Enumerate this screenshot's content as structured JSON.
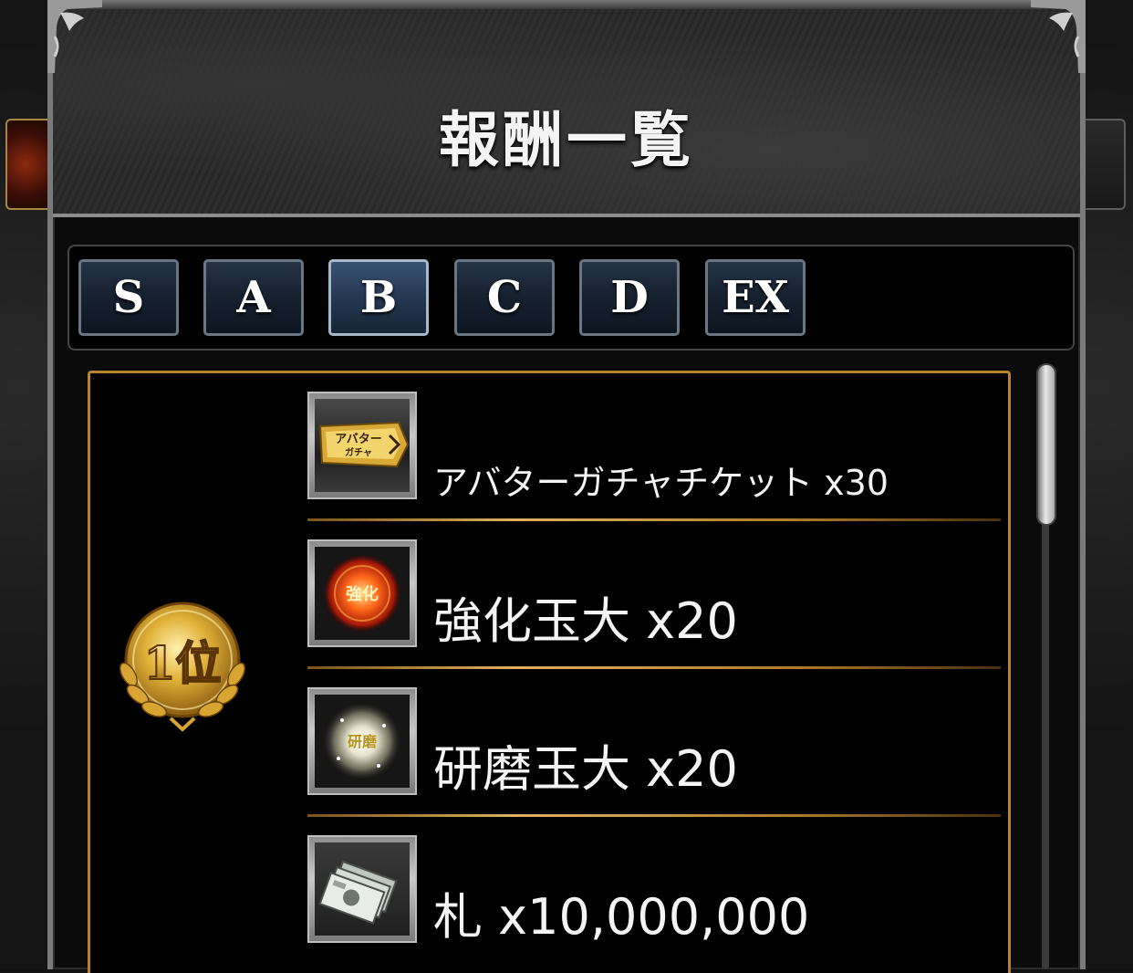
{
  "header": {
    "title": "報酬一覧"
  },
  "tabs": [
    {
      "label": "S",
      "active": false
    },
    {
      "label": "A",
      "active": false
    },
    {
      "label": "B",
      "active": true
    },
    {
      "label": "C",
      "active": false
    },
    {
      "label": "D",
      "active": false
    },
    {
      "label": "EX",
      "active": false
    }
  ],
  "rank": {
    "label": "1位"
  },
  "rewards": [
    {
      "icon": "avatar-gacha-ticket-icon",
      "ticket_text": "アバター",
      "ticket_text2": "ガチャ",
      "label": "アバターガチャチケット x30"
    },
    {
      "icon": "enhance-orb-large-icon",
      "orb_text": "強化",
      "label": "強化玉大 x20"
    },
    {
      "icon": "polish-orb-large-icon",
      "orb_text": "研磨",
      "label": "研磨玉大 x20"
    },
    {
      "icon": "banknotes-icon",
      "label": "札 x10,000,000"
    }
  ],
  "colors": {
    "accent_gold": "#b9822c",
    "tab_blue": "#16212f",
    "text": "#f4f4f4"
  }
}
